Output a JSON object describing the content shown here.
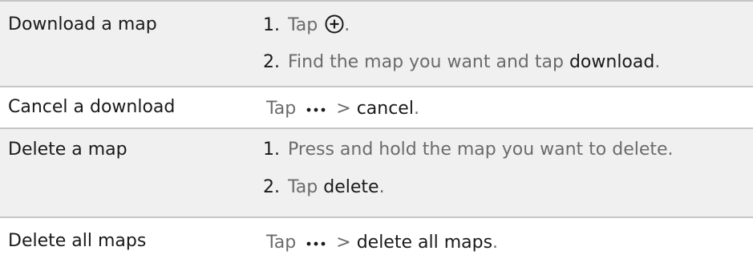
{
  "rows": [
    {
      "label": "Download a map",
      "steps": [
        {
          "num": "1.",
          "text": "Tap",
          "after": "."
        },
        {
          "num": "2.",
          "text": "Find the map you want and tap",
          "keyword": "download",
          "after": "."
        }
      ]
    },
    {
      "label": "Cancel a download",
      "step": {
        "text": "Tap",
        "sep": ">",
        "keyword": "cancel",
        "after": "."
      }
    },
    {
      "label": "Delete a map",
      "steps": [
        {
          "num": "1.",
          "text": "Press and hold the map you want to delete."
        },
        {
          "num": "2.",
          "text": "Tap",
          "keyword": "delete",
          "after": "."
        }
      ]
    },
    {
      "label": "Delete all maps",
      "step": {
        "text": "Tap",
        "sep": ">",
        "keyword": "delete all maps",
        "after": "."
      }
    }
  ],
  "icons": {
    "add": "plus-circle-icon",
    "more": "more-dots-icon"
  }
}
